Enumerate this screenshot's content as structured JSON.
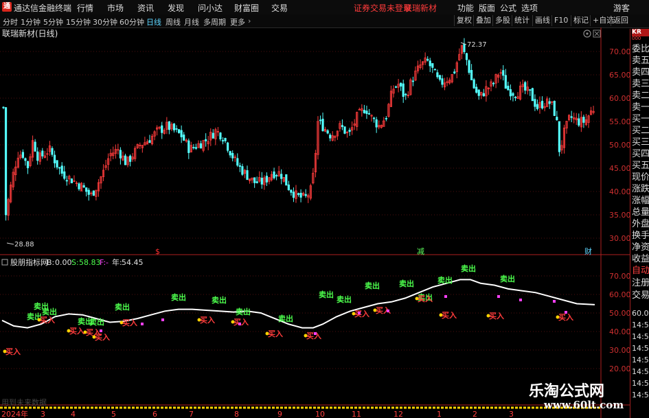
{
  "app": {
    "logo": "通",
    "title": "通达信金融终端"
  },
  "menu": [
    "行情",
    "市场",
    "资讯",
    "发现",
    "问小达",
    "财富圈",
    "交易"
  ],
  "notice": {
    "login": "证券交易未登录",
    "stock": "联瑞新材"
  },
  "right_menu": [
    "功能",
    "版面",
    "公式",
    "选项"
  ],
  "guest": "游客",
  "timeframes": [
    "分时",
    "1分钟",
    "5分钟",
    "15分钟",
    "30分钟",
    "60分钟",
    "日线",
    "周线",
    "月线",
    "多周期",
    "更多"
  ],
  "active_tf": "日线",
  "toolbar": [
    "复权",
    "叠加",
    "多股",
    "统计",
    "画线",
    "F10",
    "标记",
    "+自选",
    "返回"
  ],
  "chart_title": "联瑞新材(日线)",
  "price_axis": [
    "70.00",
    "65.00",
    "60.00",
    "55.00",
    "50.00",
    "45.00",
    "40.00",
    "35.00",
    "30.00"
  ],
  "annot": {
    "high": "72.37",
    "low": "28.88",
    "markers": [
      "$",
      "减",
      "财"
    ]
  },
  "indicator": {
    "name": "股朋指标网",
    "b_label": "B:",
    "b_value": "0.00",
    "s_label": "S:",
    "s_value": "58.83",
    "f_label": "F:",
    "f_value": "-",
    "year_label": "年:",
    "year_value": "54.45"
  },
  "ind_axis": [
    "70.00",
    "60.00",
    "50.00",
    "40.00",
    "30.00",
    "20.00"
  ],
  "signal_text": {
    "sell": "卖出",
    "buy": "买入"
  },
  "footer_note": "用到未来数据",
  "dates": [
    "2024年",
    "3",
    "4",
    "5",
    "6",
    "7",
    "8",
    "9",
    "10",
    "11",
    "12",
    "1",
    "2",
    "3"
  ],
  "side_items": [
    "委比",
    "卖五",
    "卖四",
    "卖三",
    "卖二",
    "卖一",
    "买一",
    "买二",
    "买三",
    "买四",
    "买五",
    "现价",
    "涨跌",
    "涨幅",
    "总量",
    "外盘",
    "换手",
    "净资",
    "收益"
  ],
  "side_bottom": [
    "自动",
    "注册",
    "交易"
  ],
  "side_badge": "KR",
  "side_badge2": "000",
  "side_times": [
    "60.00",
    "14:5",
    "14:5",
    "14:5",
    "14:5",
    "14:5",
    "14:5",
    "14:5"
  ],
  "watermark": {
    "cn": "乐淘公式网",
    "url": "www.60lt.com"
  },
  "colors": {
    "up": "#ff3c3c",
    "down": "#54ffff",
    "axis_red": "#d03030",
    "signal_green": "#4dff4d",
    "signal_magenta": "#ff40ff"
  }
}
